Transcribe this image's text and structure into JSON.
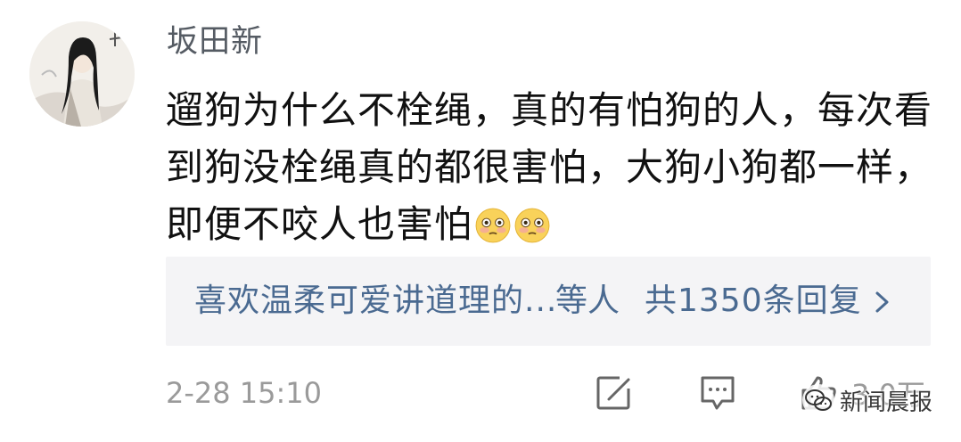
{
  "comment": {
    "username": "坂田新",
    "text": "遛狗为什么不栓绳，真的有怕狗的人，每次看到狗没栓绳真的都很害怕，大狗小狗都一样，即便不咬人也害怕",
    "emoji": [
      "flushed-face",
      "flushed-face"
    ],
    "replies": {
      "names": "喜欢温柔可爱讲道理的...",
      "suffix": "等人",
      "count_text": "共1350条回复"
    },
    "timestamp": "2-28 15:10",
    "like_count": "3.0万"
  },
  "watermark": {
    "text": "新闻晨报"
  },
  "colors": {
    "link": "#4a6a91",
    "meta": "#9a9a9a",
    "reply_bg": "#f4f4f6"
  }
}
